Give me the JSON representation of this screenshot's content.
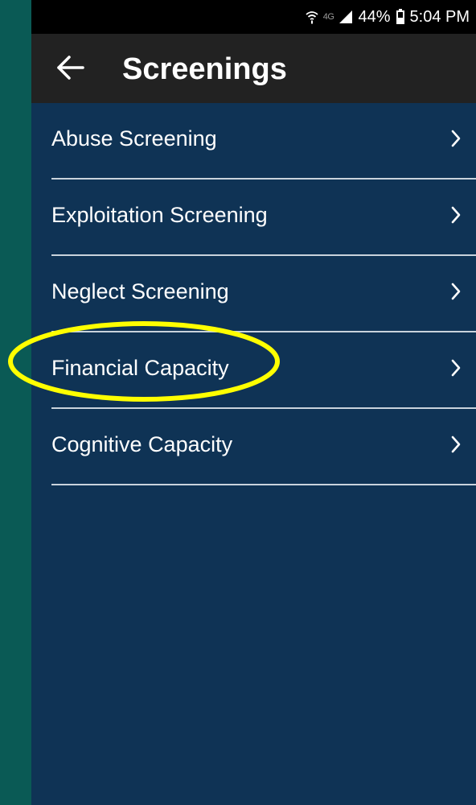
{
  "status_bar": {
    "network_label": "4G",
    "battery": "44%",
    "time": "5:04 PM",
    "icons": [
      "wifi-icon",
      "signal-icon",
      "battery-icon"
    ]
  },
  "app_bar": {
    "title": "Screenings",
    "back_icon": "arrow-left-icon"
  },
  "menu": {
    "items": [
      {
        "label": "Abuse Screening"
      },
      {
        "label": "Exploitation Screening"
      },
      {
        "label": "Neglect Screening"
      },
      {
        "label": "Financial Capacity"
      },
      {
        "label": "Cognitive Capacity"
      }
    ],
    "item_icon": "chevron-right-icon"
  },
  "annotation": {
    "highlighted_item": "Financial Capacity",
    "color": "#ffff00"
  },
  "colors": {
    "page_bg": "#0f3355",
    "app_bar_bg": "#222222",
    "status_bar_bg": "#000000",
    "divider": "#c9d3dc",
    "outer_bg": "#0a5a55"
  }
}
